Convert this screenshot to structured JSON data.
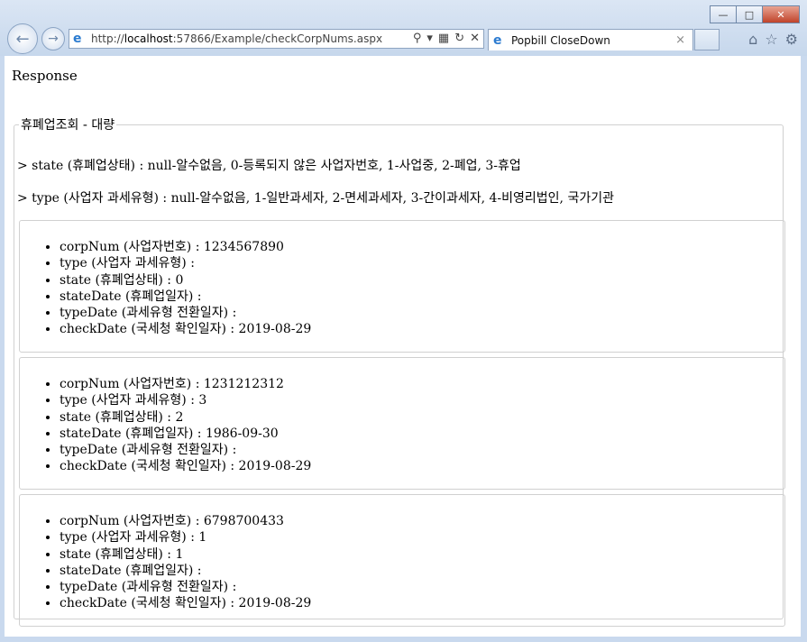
{
  "window": {
    "minimize": "—",
    "maximize": "□",
    "close": "✕"
  },
  "browser": {
    "back_icon": "back-arrow-icon",
    "forward_icon": "forward-arrow-icon",
    "url_prefix": "http://",
    "url_host": "localhost",
    "url_rest": ":57866/Example/checkCorpNums.aspx",
    "tab_title": "Popbill CloseDown",
    "tab_close": "×"
  },
  "page": {
    "response_label": "Response",
    "legend": "휴폐업조회 - 대량",
    "state_desc": "> state (휴폐업상태) : null-알수없음, 0-등록되지 않은 사업자번호, 1-사업중, 2-폐업, 3-휴업",
    "type_desc": "> type (사업자 과세유형) : null-알수없음, 1-일반과세자, 2-면세과세자, 3-간이과세자, 4-비영리법인, 국가기관",
    "results": [
      {
        "corpNum": "corpNum (사업자번호) : 1234567890",
        "type": "type (사업자 과세유형) :",
        "state": "state (휴폐업상태) : 0",
        "stateDate": "stateDate (휴폐업일자) :",
        "typeDate": "typeDate (과세유형 전환일자) :",
        "checkDate": "checkDate (국세청 확인일자) : 2019-08-29"
      },
      {
        "corpNum": "corpNum (사업자번호) : 1231212312",
        "type": "type (사업자 과세유형) : 3",
        "state": "state (휴폐업상태) : 2",
        "stateDate": "stateDate (휴폐업일자) : 1986-09-30",
        "typeDate": "typeDate (과세유형 전환일자) :",
        "checkDate": "checkDate (국세청 확인일자) : 2019-08-29"
      },
      {
        "corpNum": "corpNum (사업자번호) : 6798700433",
        "type": "type (사업자 과세유형) : 1",
        "state": "state (휴폐업상태) : 1",
        "stateDate": "stateDate (휴폐업일자) :",
        "typeDate": "typeDate (과세유형 전환일자) :",
        "checkDate": "checkDate (국세청 확인일자) : 2019-08-29"
      }
    ]
  }
}
